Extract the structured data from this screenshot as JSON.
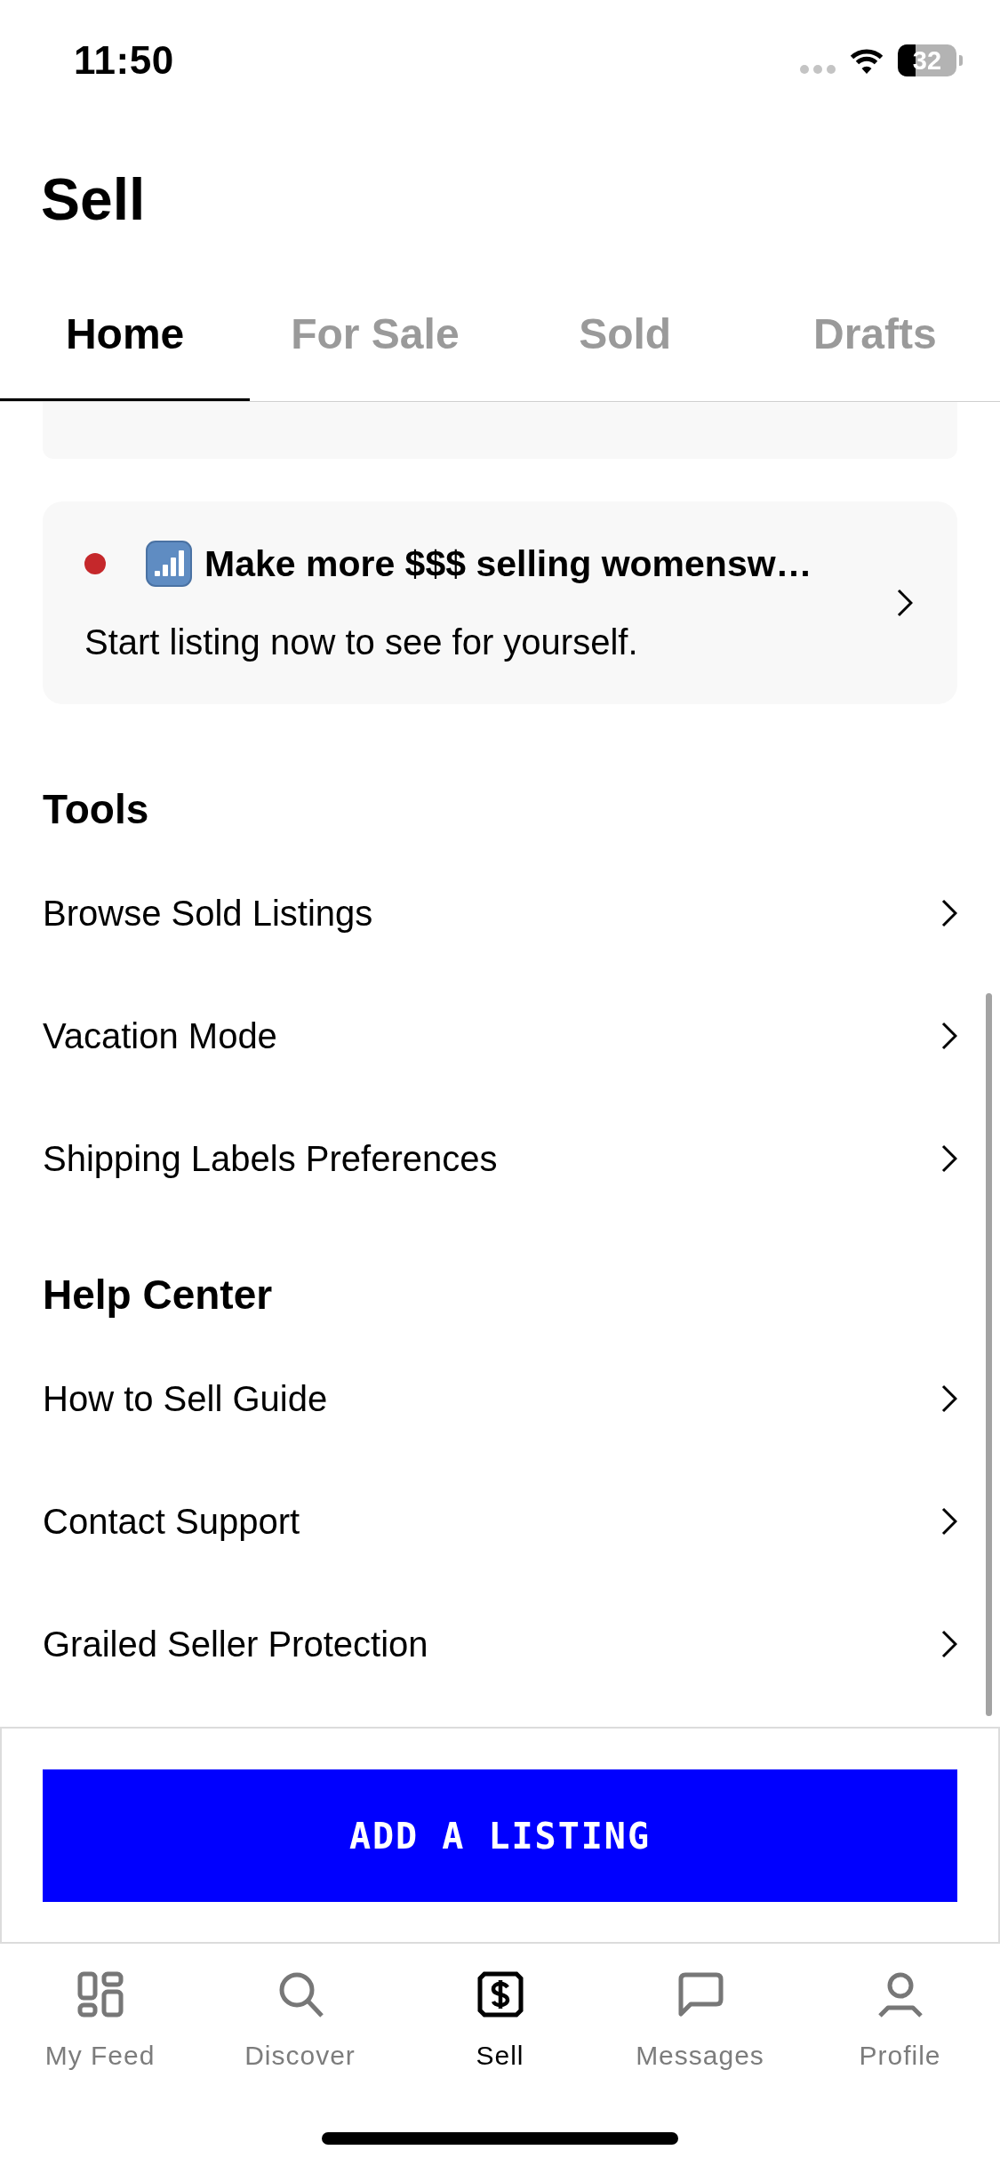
{
  "status_bar": {
    "time": "11:50",
    "battery": "32"
  },
  "header": {
    "title": "Sell"
  },
  "tabs": [
    {
      "label": "Home",
      "selected": true
    },
    {
      "label": "For Sale",
      "selected": false
    },
    {
      "label": "Sold",
      "selected": false
    },
    {
      "label": "Drafts",
      "selected": false
    }
  ],
  "promo_card": {
    "unread": true,
    "title": "Make more $$$ selling womensw…",
    "subtitle": "Start listing now to see for yourself."
  },
  "sections": [
    {
      "title": "Tools",
      "items": [
        {
          "label": "Browse Sold Listings"
        },
        {
          "label": "Vacation Mode"
        },
        {
          "label": "Shipping Labels Preferences"
        }
      ]
    },
    {
      "title": "Help Center",
      "items": [
        {
          "label": "How to Sell Guide"
        },
        {
          "label": "Contact Support"
        },
        {
          "label": "Grailed Seller Protection"
        }
      ]
    }
  ],
  "primary_button": {
    "label": "ADD A LISTING"
  },
  "tab_bar": [
    {
      "label": "My Feed",
      "selected": false
    },
    {
      "label": "Discover",
      "selected": false
    },
    {
      "label": "Sell",
      "selected": true
    },
    {
      "label": "Messages",
      "selected": false
    },
    {
      "label": "Profile",
      "selected": false
    }
  ]
}
